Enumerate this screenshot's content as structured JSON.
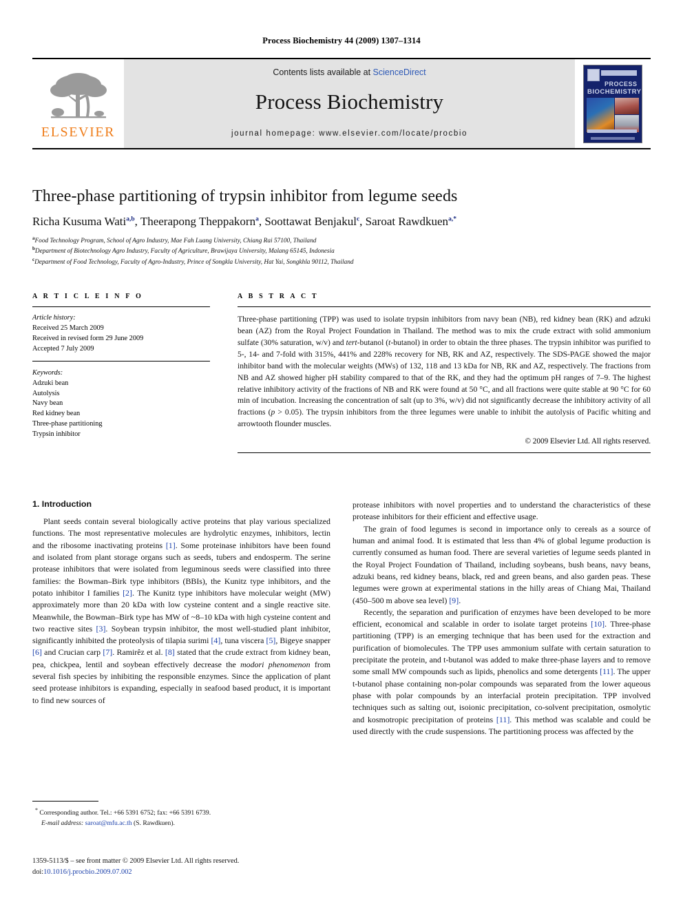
{
  "running_head": "Process Biochemistry 44 (2009) 1307–1314",
  "masthead": {
    "contents_prefix": "Contents lists available at ",
    "sciencedirect": "ScienceDirect",
    "journal_title": "Process Biochemistry",
    "homepage": "journal homepage: www.elsevier.com/locate/procbio",
    "publisher_wordmark": "ELSEVIER",
    "publisher_color": "#ef7d1a",
    "cover": {
      "line1": "PROCESS",
      "line2": "BIOCHEMISTRY",
      "background_color": "#14226b"
    }
  },
  "article": {
    "title": "Three-phase partitioning of trypsin inhibitor from legume seeds",
    "authors": [
      {
        "name": "Richa Kusuma Wati",
        "marks": "a,b"
      },
      {
        "name": "Theerapong Theppakorn",
        "marks": "a"
      },
      {
        "name": "Soottawat Benjakul",
        "marks": "c"
      },
      {
        "name": "Saroat Rawdkuen",
        "marks": "a,*"
      }
    ],
    "affiliations": [
      {
        "mark": "a",
        "text": "Food Technology Program, School of Agro Industry, Mae Fah Luang University, Chiang Rai 57100, Thailand"
      },
      {
        "mark": "b",
        "text": "Department of Biotechnology Agro Industry, Faculty of Agriculture, Brawijaya University, Malang 65145, Indonesia"
      },
      {
        "mark": "c",
        "text": "Department of Food Technology, Faculty of Agro-Industry, Prince of Songkla University, Hat Yai, Songkhla 90112, Thailand"
      }
    ]
  },
  "article_info": {
    "heading": "A R T I C L E   I N F O",
    "history_label": "Article history:",
    "history": [
      "Received 25 March 2009",
      "Received in revised form 29 June 2009",
      "Accepted 7 July 2009"
    ],
    "keywords_label": "Keywords:",
    "keywords": [
      "Adzuki bean",
      "Autolysis",
      "Navy bean",
      "Red kidney bean",
      "Three-phase partitioning",
      "Trypsin inhibitor"
    ]
  },
  "abstract": {
    "heading": "A B S T R A C T",
    "part1": "Three-phase partitioning (TPP) was used to isolate trypsin inhibitors from navy bean (NB), red kidney bean (RK) and adzuki bean (AZ) from the Royal Project Foundation in Thailand. The method was to mix the crude extract with solid ammonium sulfate (30% saturation, w/v) and ",
    "italic1": "tert",
    "part2": "-butanol (",
    "italic2": "t",
    "part3": "-butanol) in order to obtain the three phases. The trypsin inhibitor was purified to 5-, 14- and 7-fold with 315%, 441% and 228% recovery for NB, RK and AZ, respectively. The SDS-PAGE showed the major inhibitor band with the molecular weights (MWs) of 132, 118 and 13 kDa for NB, RK and AZ, respectively. The fractions from NB and AZ showed higher pH stability compared to that of the RK, and they had the optimum pH ranges of 7–9. The highest relative inhibitory activity of the fractions of NB and RK were found at 50 °C, and all fractions were quite stable at 90 °C for 60 min of incubation. Increasing the concentration of salt (up to 3%, w/v) did not significantly decrease the inhibitory activity of all fractions (",
    "italic3": "p",
    "part4": " > 0.05). The trypsin inhibitors from the three legumes were unable to inhibit the autolysis of Pacific whiting and arrowtooth flounder muscles.",
    "copyright": "© 2009 Elsevier Ltd. All rights reserved."
  },
  "introduction": {
    "heading": "1. Introduction",
    "left_paragraphs": [
      {
        "segments": [
          {
            "t": "Plant seeds contain several biologically active proteins that play various specialized functions. The most representative molecules are hydrolytic enzymes, inhibitors, lectin and the ribosome inactivating proteins "
          },
          {
            "t": "[1]",
            "s": "ref"
          },
          {
            "t": ". Some proteinase inhibitors have been found and isolated from plant storage organs such as seeds, tubers and endosperm. The serine protease inhibitors that were isolated from leguminous seeds were classified into three families: the Bowman–Birk type inhibitors (BBIs), the Kunitz type inhibitors, and the potato inhibitor I families "
          },
          {
            "t": "[2]",
            "s": "ref"
          },
          {
            "t": ". The Kunitz type inhibitors have molecular weight (MW) approximately more than 20 kDa with low cysteine content and a single reactive site. Meanwhile, the Bowman–Birk type has MW of ~8–10 kDa with high cysteine content and two reactive sites "
          },
          {
            "t": "[3]",
            "s": "ref"
          },
          {
            "t": ". Soybean trypsin inhibitor, the most well-studied plant inhibitor, significantly inhibited the proteolysis of tilapia surimi "
          },
          {
            "t": "[4]",
            "s": "ref"
          },
          {
            "t": ", tuna viscera "
          },
          {
            "t": "[5]",
            "s": "ref"
          },
          {
            "t": ", Bigeye snapper "
          },
          {
            "t": "[6]",
            "s": "ref"
          },
          {
            "t": " and Crucian carp "
          },
          {
            "t": "[7]",
            "s": "ref"
          },
          {
            "t": ". Ramirêz et al. "
          },
          {
            "t": "[8]",
            "s": "ref"
          },
          {
            "t": " stated that the crude extract from kidney bean, pea, chickpea, lentil and soybean effectively decrease the "
          },
          {
            "t": "modori phenomenon",
            "s": "it"
          },
          {
            "t": " from several fish species by inhibiting the responsible enzymes. Since the application of plant seed protease inhibitors is expanding, especially in seafood based product, it is important to find new sources of "
          }
        ]
      }
    ],
    "right_paragraphs": [
      {
        "indent": false,
        "segments": [
          {
            "t": "protease inhibitors with novel properties and to understand the characteristics of these protease inhibitors for their efficient and effective usage."
          }
        ]
      },
      {
        "indent": true,
        "segments": [
          {
            "t": "The grain of food legumes is second in importance only to cereals as a source of human and animal food. It is estimated that less than 4% of global legume production is currently consumed as human food. There are several varieties of legume seeds planted in the Royal Project Foundation of Thailand, including soybeans, bush beans, navy beans, adzuki beans, red kidney beans, black, red and green beans, and also garden peas. These legumes were grown at experimental stations in the hilly areas of Chiang Mai, Thailand (450–500 m above sea level) "
          },
          {
            "t": "[9]",
            "s": "ref"
          },
          {
            "t": "."
          }
        ]
      },
      {
        "indent": true,
        "segments": [
          {
            "t": "Recently, the separation and purification of enzymes have been developed to be more efficient, economical and scalable in order to isolate target proteins "
          },
          {
            "t": "[10]",
            "s": "ref"
          },
          {
            "t": ". Three-phase partitioning (TPP) is an emerging technique that has been used for the extraction and purification of biomolecules. The TPP uses ammonium sulfate with certain saturation to precipitate the protein, and t-butanol was added to make three-phase layers and to remove some small MW compounds such as lipids, phenolics and some detergents "
          },
          {
            "t": "[11]",
            "s": "ref"
          },
          {
            "t": ". The upper t-butanol phase containing non-polar compounds was separated from the lower aqueous phase with polar compounds by an interfacial protein precipitation. TPP involved techniques such as salting out, isoionic precipitation, co-solvent precipitation, osmolytic and kosmotropic precipitation of proteins "
          },
          {
            "t": "[11]",
            "s": "ref"
          },
          {
            "t": ". This method was scalable and could be used directly with the crude suspensions. The partitioning process was affected by the "
          }
        ]
      }
    ]
  },
  "footnote": {
    "marker": "*",
    "line1": "Corresponding author. Tel.: +66 5391 6752; fax: +66 5391 6739.",
    "email_label": "E-mail address:",
    "email": "saroat@mfu.ac.th",
    "email_suffix": " (S. Rawdkuen)."
  },
  "colophon": {
    "line1": "1359-5113/$ – see front matter © 2009 Elsevier Ltd. All rights reserved.",
    "doi_label": "doi:",
    "doi": "10.1016/j.procbio.2009.07.002"
  }
}
